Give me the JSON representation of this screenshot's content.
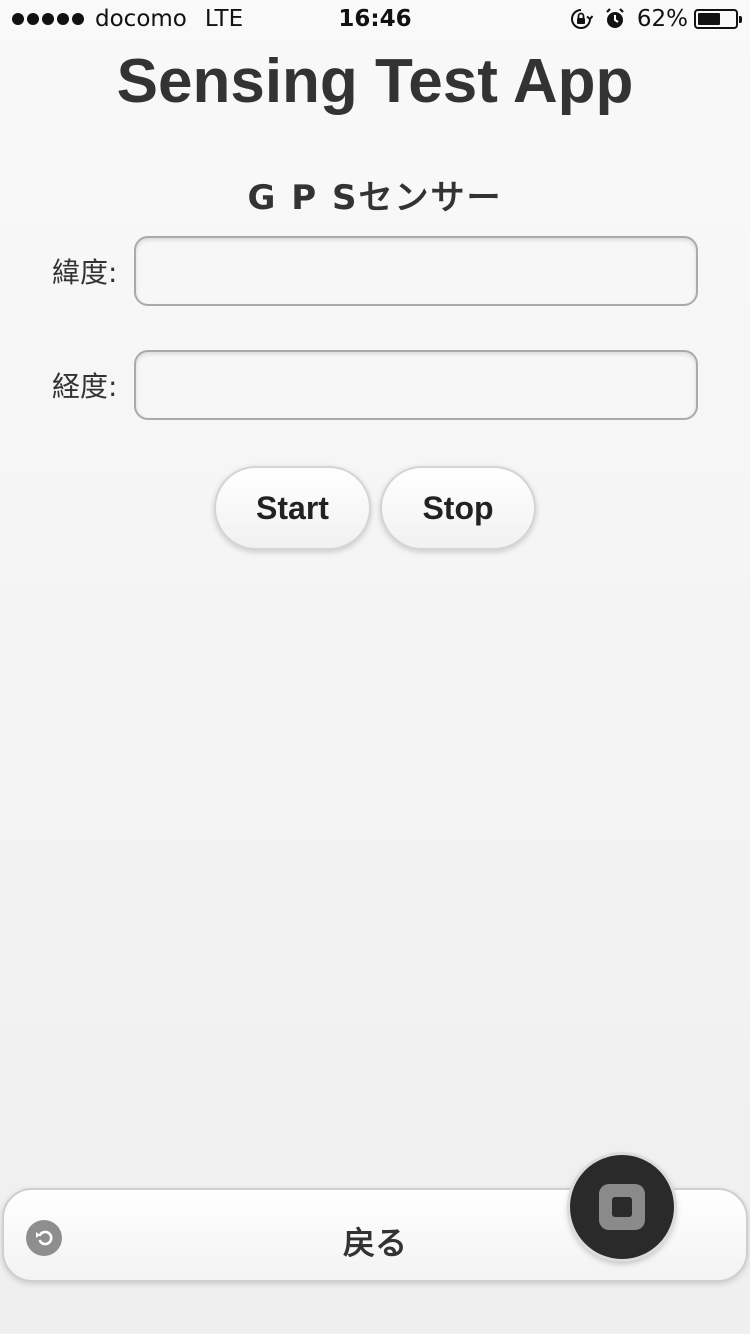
{
  "status_bar": {
    "carrier": "docomo",
    "network": "LTE",
    "time": "16:46",
    "battery_percent": "62%",
    "battery_level": 0.62,
    "signal_bars": 5,
    "icons": [
      "signal-icon",
      "orientation-lock-icon",
      "alarm-icon",
      "battery-icon"
    ]
  },
  "header": {
    "title": "Sensing Test App"
  },
  "gps": {
    "section_title": "G P Sセンサー",
    "latitude_label": "緯度:",
    "latitude_value": "",
    "longitude_label": "経度:",
    "longitude_value": "",
    "start_label": "Start",
    "stop_label": "Stop"
  },
  "bottom_bar": {
    "back_label": "戻る",
    "back_icon": "undo-icon"
  },
  "fab": {
    "icon": "stop-icon"
  },
  "colors": {
    "background": "#f4f4f4",
    "text": "#333333",
    "fab": "#2a2a2a",
    "icon_gray": "#8e8e8e"
  }
}
